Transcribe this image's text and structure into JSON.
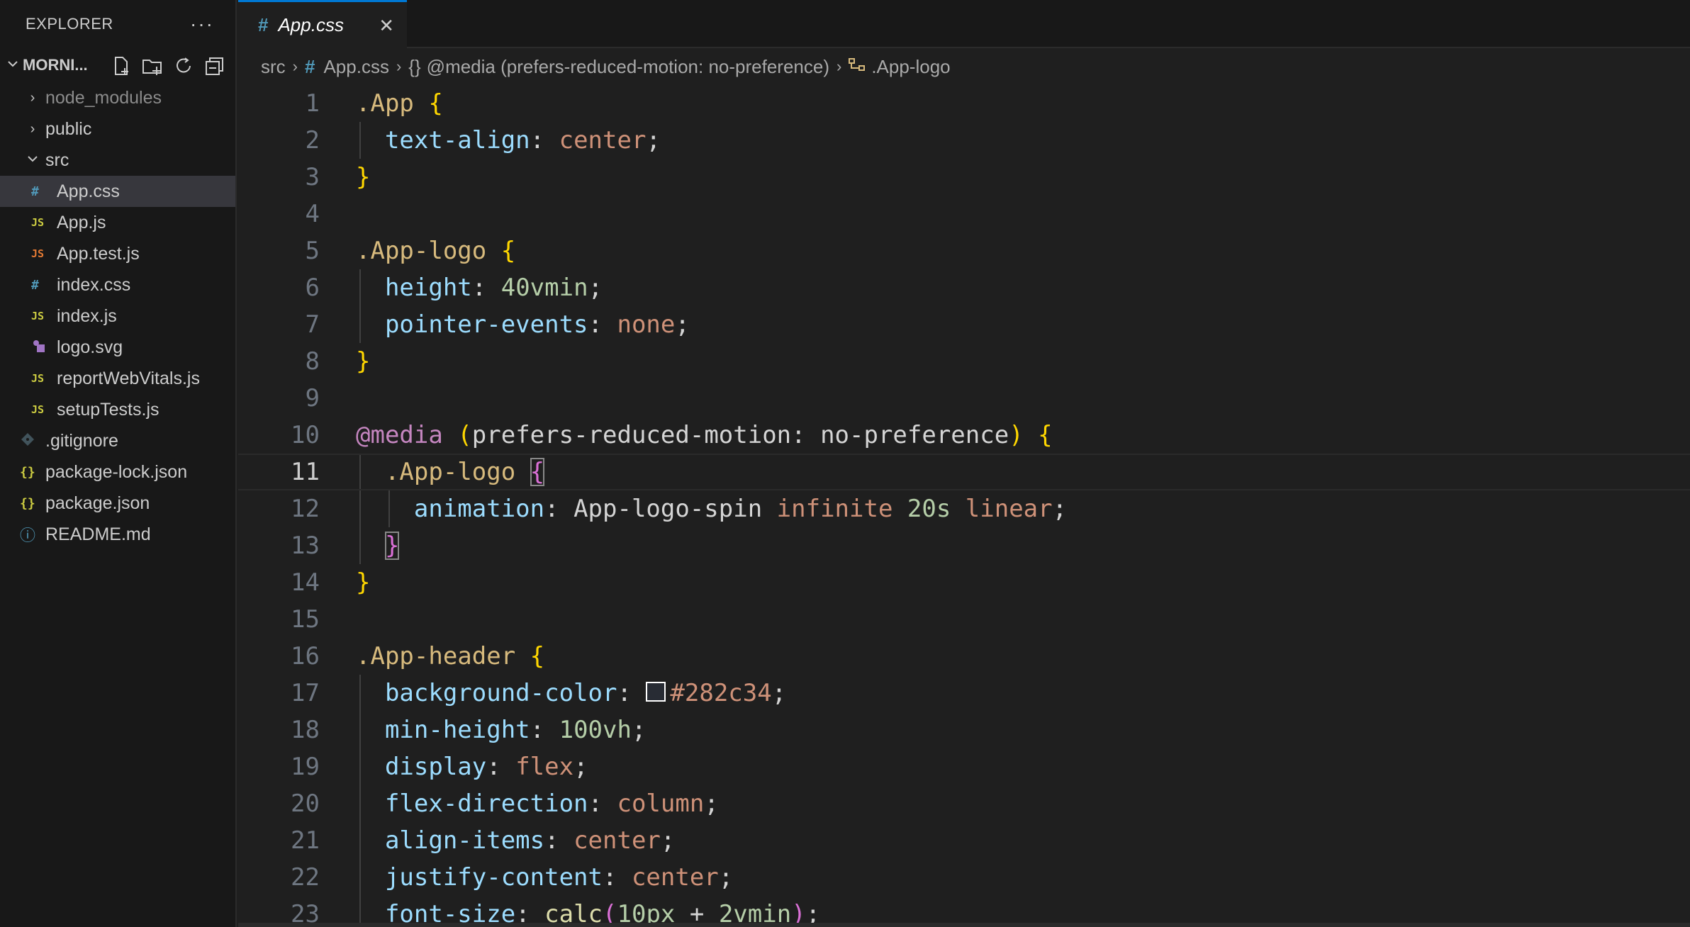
{
  "sidebar": {
    "title": "EXPLORER",
    "more": "···",
    "project": "MORNI...",
    "items": [
      {
        "label": "node_modules",
        "kind": "folder-closed",
        "level": 0
      },
      {
        "label": "public",
        "kind": "folder-closed",
        "level": 0
      },
      {
        "label": "src",
        "kind": "folder-open",
        "level": 0
      },
      {
        "label": "App.css",
        "kind": "css",
        "icon_text": "#",
        "level": 1,
        "selected": true
      },
      {
        "label": "App.js",
        "kind": "js",
        "icon_text": "JS",
        "level": 1
      },
      {
        "label": "App.test.js",
        "kind": "js-test",
        "icon_text": "JS",
        "level": 1
      },
      {
        "label": "index.css",
        "kind": "css",
        "icon_text": "#",
        "level": 1
      },
      {
        "label": "index.js",
        "kind": "js",
        "icon_text": "JS",
        "level": 1
      },
      {
        "label": "logo.svg",
        "kind": "svg",
        "level": 1
      },
      {
        "label": "reportWebVitals.js",
        "kind": "js",
        "icon_text": "JS",
        "level": 1
      },
      {
        "label": "setupTests.js",
        "kind": "js",
        "icon_text": "JS",
        "level": 1
      },
      {
        "label": ".gitignore",
        "kind": "git",
        "level": 0
      },
      {
        "label": "package-lock.json",
        "kind": "json",
        "icon_text": "{}",
        "level": 0
      },
      {
        "label": "package.json",
        "kind": "json",
        "icon_text": "{}",
        "level": 0
      },
      {
        "label": "README.md",
        "kind": "info",
        "icon_text": "ⓘ",
        "level": 0
      }
    ]
  },
  "tab": {
    "icon_text": "#",
    "label": "App.css",
    "close": "✕"
  },
  "breadcrumb": {
    "p1": "src",
    "p2_icon": "#",
    "p2": "App.css",
    "p3_icon": "{}",
    "p3": "@media (prefers-reduced-motion: no-preference)",
    "p4": ".App-logo"
  },
  "editor": {
    "current_line": 11,
    "lines": [
      [
        {
          "t": ".App ",
          "c": "sel"
        },
        {
          "t": "{",
          "c": "br"
        }
      ],
      [
        {
          "t": "  "
        },
        {
          "t": "text-align",
          "c": "prop"
        },
        {
          "t": ": ",
          "c": "txt"
        },
        {
          "t": "center",
          "c": "val"
        },
        {
          "t": ";",
          "c": "txt"
        }
      ],
      [
        {
          "t": "}",
          "c": "br"
        }
      ],
      [],
      [
        {
          "t": ".App-logo ",
          "c": "sel"
        },
        {
          "t": "{",
          "c": "br"
        }
      ],
      [
        {
          "t": "  "
        },
        {
          "t": "height",
          "c": "prop"
        },
        {
          "t": ": ",
          "c": "txt"
        },
        {
          "t": "40vmin",
          "c": "num"
        },
        {
          "t": ";",
          "c": "txt"
        }
      ],
      [
        {
          "t": "  "
        },
        {
          "t": "pointer-events",
          "c": "prop"
        },
        {
          "t": ": ",
          "c": "txt"
        },
        {
          "t": "none",
          "c": "val"
        },
        {
          "t": ";",
          "c": "txt"
        }
      ],
      [
        {
          "t": "}",
          "c": "br"
        }
      ],
      [],
      [
        {
          "t": "@media",
          "c": "at"
        },
        {
          "t": " ",
          "c": "txt"
        },
        {
          "t": "(",
          "c": "br"
        },
        {
          "t": "prefers-reduced-motion: no-preference",
          "c": "txt"
        },
        {
          "t": ")",
          "c": "br"
        },
        {
          "t": " ",
          "c": "txt"
        },
        {
          "t": "{",
          "c": "br"
        }
      ],
      [
        {
          "t": "  "
        },
        {
          "t": ".App-logo ",
          "c": "sel"
        },
        {
          "t": "{",
          "c": "br2 box-br"
        }
      ],
      [
        {
          "t": "    "
        },
        {
          "t": "animation",
          "c": "prop"
        },
        {
          "t": ": ",
          "c": "txt"
        },
        {
          "t": "App-logo-spin ",
          "c": "txt"
        },
        {
          "t": "infinite ",
          "c": "val"
        },
        {
          "t": "20s ",
          "c": "num"
        },
        {
          "t": "linear",
          "c": "val"
        },
        {
          "t": ";",
          "c": "txt"
        }
      ],
      [
        {
          "t": "  "
        },
        {
          "t": "}",
          "c": "br2 box-br"
        }
      ],
      [
        {
          "t": "}",
          "c": "br"
        }
      ],
      [],
      [
        {
          "t": ".App-header ",
          "c": "sel"
        },
        {
          "t": "{",
          "c": "br"
        }
      ],
      [
        {
          "t": "  "
        },
        {
          "t": "background-color",
          "c": "prop"
        },
        {
          "t": ": ",
          "c": "txt"
        },
        {
          "swatch": "#282c34"
        },
        {
          "t": "#282c34",
          "c": "val"
        },
        {
          "t": ";",
          "c": "txt"
        }
      ],
      [
        {
          "t": "  "
        },
        {
          "t": "min-height",
          "c": "prop"
        },
        {
          "t": ": ",
          "c": "txt"
        },
        {
          "t": "100vh",
          "c": "num"
        },
        {
          "t": ";",
          "c": "txt"
        }
      ],
      [
        {
          "t": "  "
        },
        {
          "t": "display",
          "c": "prop"
        },
        {
          "t": ": ",
          "c": "txt"
        },
        {
          "t": "flex",
          "c": "val"
        },
        {
          "t": ";",
          "c": "txt"
        }
      ],
      [
        {
          "t": "  "
        },
        {
          "t": "flex-direction",
          "c": "prop"
        },
        {
          "t": ": ",
          "c": "txt"
        },
        {
          "t": "column",
          "c": "val"
        },
        {
          "t": ";",
          "c": "txt"
        }
      ],
      [
        {
          "t": "  "
        },
        {
          "t": "align-items",
          "c": "prop"
        },
        {
          "t": ": ",
          "c": "txt"
        },
        {
          "t": "center",
          "c": "val"
        },
        {
          "t": ";",
          "c": "txt"
        }
      ],
      [
        {
          "t": "  "
        },
        {
          "t": "justify-content",
          "c": "prop"
        },
        {
          "t": ": ",
          "c": "txt"
        },
        {
          "t": "center",
          "c": "val"
        },
        {
          "t": ";",
          "c": "txt"
        }
      ],
      [
        {
          "t": "  "
        },
        {
          "t": "font-size",
          "c": "prop"
        },
        {
          "t": ": ",
          "c": "txt"
        },
        {
          "t": "calc",
          "c": "fn"
        },
        {
          "t": "(",
          "c": "br2"
        },
        {
          "t": "10px",
          "c": "num"
        },
        {
          "t": " + ",
          "c": "txt"
        },
        {
          "t": "2vmin",
          "c": "num"
        },
        {
          "t": ")",
          "c": "br2"
        },
        {
          "t": ";",
          "c": "txt"
        }
      ]
    ],
    "indent_depth": [
      0,
      1,
      0,
      0,
      0,
      1,
      1,
      0,
      0,
      0,
      1,
      2,
      1,
      0,
      0,
      0,
      1,
      1,
      1,
      1,
      1,
      1,
      1
    ]
  },
  "colors": {
    "accent": "#0078d4",
    "css_icon": "#519aba",
    "js_icon": "#cbcb41",
    "js_test_icon": "#e37933",
    "json_icon": "#cbcb41",
    "svg_icon": "#a074c4",
    "info_icon": "#519aba",
    "git_icon": "#41535b"
  }
}
